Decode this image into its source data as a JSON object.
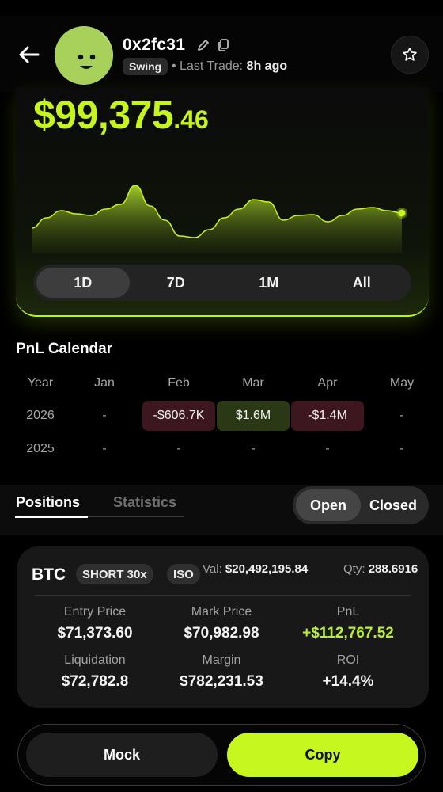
{
  "header": {
    "handle": "0x2fc31",
    "badge": "Swing",
    "last_trade_label": "Last Trade:",
    "last_trade_value": "8h ago",
    "icons": {
      "back": "arrow-left-icon",
      "edit": "pencil-icon",
      "copy": "copy-icon",
      "favorite": "star-icon",
      "avatar": "smiley-face-avatar"
    }
  },
  "balance": {
    "whole": "$99,375",
    "cents": ".46"
  },
  "range_selector": {
    "options": [
      "1D",
      "7D",
      "1M",
      "All"
    ],
    "selected": "1D"
  },
  "chart_data": {
    "type": "area",
    "title": "",
    "series": [
      {
        "values": [
          0.22,
          0.35,
          0.44,
          0.4,
          0.38,
          0.46,
          0.52,
          0.76,
          0.5,
          0.32,
          0.12,
          0.1,
          0.2,
          0.35,
          0.46,
          0.58,
          0.55,
          0.32,
          0.38,
          0.39,
          0.3,
          0.38,
          0.46,
          0.48,
          0.44,
          0.41
        ]
      }
    ],
    "accent_color": "#c6f41f"
  },
  "pnl_calendar": {
    "title": "PnL Calendar",
    "columns": [
      "Year",
      "Jan",
      "Feb",
      "Mar",
      "Apr",
      "May"
    ],
    "rows": [
      {
        "year": "2026",
        "cells": [
          "-",
          "-$606.7K",
          "$1.6M",
          "-$1.4M",
          "-"
        ],
        "signs": [
          "none",
          "neg",
          "pos",
          "neg",
          "none"
        ]
      },
      {
        "year": "2025",
        "cells": [
          "-",
          "-",
          "-",
          "-",
          "-"
        ],
        "signs": [
          "none",
          "none",
          "none",
          "none",
          "none"
        ]
      }
    ]
  },
  "tabs": {
    "positions": "Positions",
    "statistics": "Statistics",
    "active": "Positions"
  },
  "filter": {
    "open": "Open",
    "closed": "Closed",
    "active": "Open"
  },
  "position": {
    "symbol": "BTC",
    "side": "SHORT 30x",
    "margin_mode": "ISO",
    "value_label": "Val:",
    "value": "$20,492,195.84",
    "qty_label": "Qty:",
    "qty": "288.6916",
    "metrics": [
      {
        "label": "Entry Price",
        "value": "$71,373.60"
      },
      {
        "label": "Mark Price",
        "value": "$70,982.98"
      },
      {
        "label": "PnL",
        "value": "+$112,767.52"
      },
      {
        "label": "Liquidation",
        "value": "$72,782.8"
      },
      {
        "label": "Margin",
        "value": "$782,231.53"
      },
      {
        "label": "ROI",
        "value": "+14.4%"
      }
    ]
  },
  "actions": {
    "mock": "Mock",
    "copy": "Copy"
  }
}
